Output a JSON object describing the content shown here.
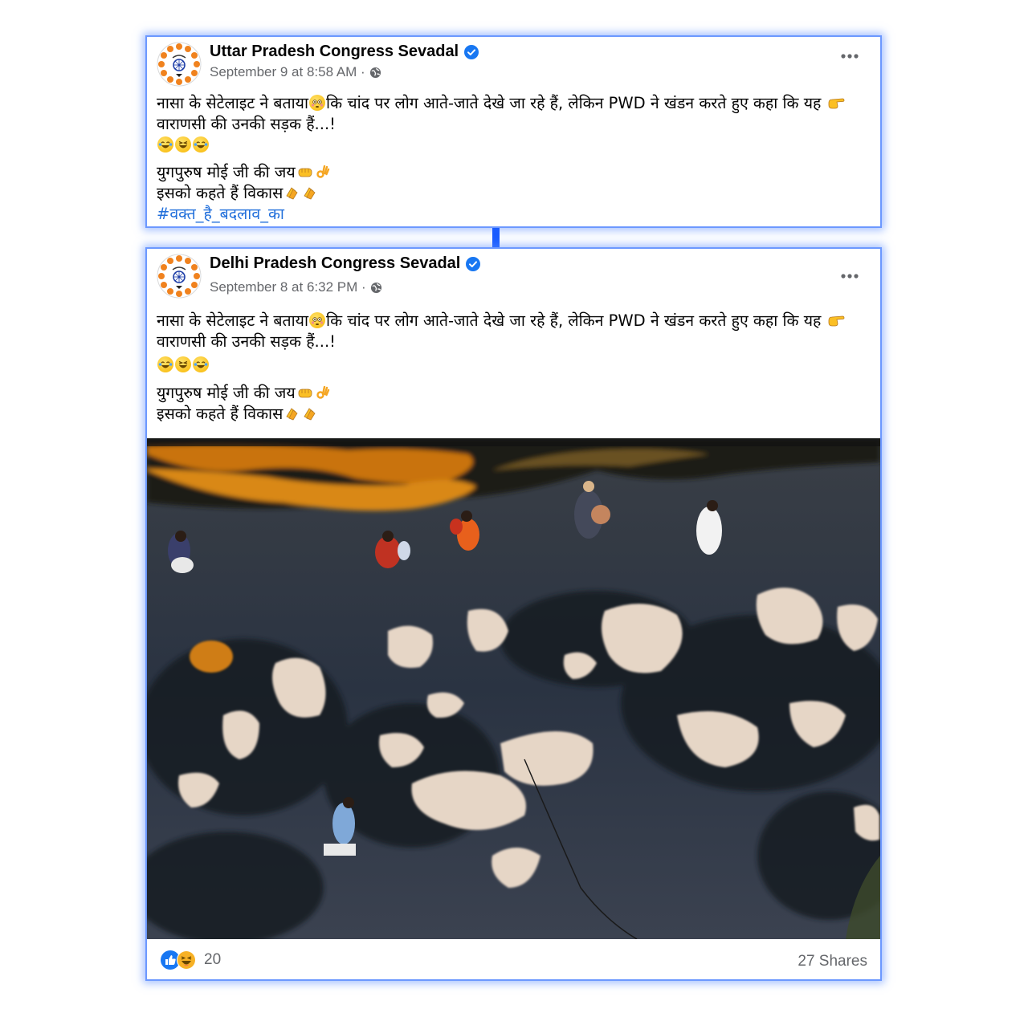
{
  "posts": [
    {
      "author": "Uttar Pradesh Congress Sevadal",
      "timestamp": "September 9 at 8:58 AM ·",
      "text_line1_a": "नासा के सेटेलाइट ने बताया",
      "text_line1_b": "कि चांद पर लोग आते-जाते देखे जा रहे हैं,  लेकिन PWD ने खंडन करते हुए कहा कि यह ",
      "text_line2": "वाराणसी की उनकी सड़क हैं...!",
      "text_line4": "युगपुरुष मोई जी की जय",
      "text_line5": "इसको कहते हैं विकास",
      "hashtag": "#वक्त_है_बदलाव_का"
    },
    {
      "author": "Delhi Pradesh Congress Sevadal",
      "timestamp": "September 8 at 6:32 PM ·",
      "text_line1_a": "नासा के सेटेलाइट ने बताया",
      "text_line1_b": "कि चांद पर लोग आते-जाते देखे जा रहे हैं,  लेकिन PWD ने खंडन करते हुए कहा कि यह ",
      "text_line2": "वाराणसी की उनकी सड़क हैं...!",
      "text_line4": "युगपुरुष मोई जी की जय",
      "text_line5": "इसको कहते हैं विकास",
      "reaction_count": "20",
      "shares": "27 Shares"
    }
  ],
  "icons": [
    "verified-badge-icon",
    "globe-icon",
    "more-options-icon",
    "like-reaction-icon",
    "haha-reaction-icon"
  ],
  "colors": {
    "frame_border": "#6c98ff",
    "connector": "#1a5cff",
    "verified": "#1877f2",
    "hashtag": "#216fdb",
    "meta": "#65676b"
  }
}
